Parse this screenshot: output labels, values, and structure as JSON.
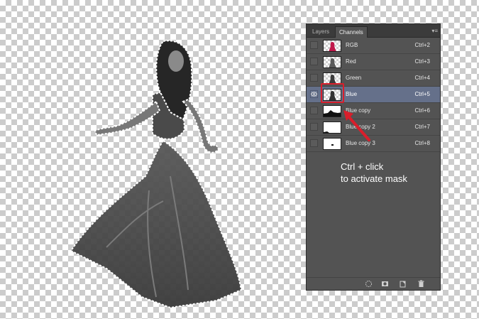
{
  "tabs": [
    {
      "label": "Layers",
      "active": false
    },
    {
      "label": "Channels",
      "active": true
    }
  ],
  "channels": [
    {
      "name": "RGB",
      "shortcut": "Ctrl+2",
      "visible": false,
      "selected": false,
      "thumb_icon": "rgb-thumbnail"
    },
    {
      "name": "Red",
      "shortcut": "Ctrl+3",
      "visible": false,
      "selected": false,
      "thumb_icon": "red-channel-thumbnail"
    },
    {
      "name": "Green",
      "shortcut": "Ctrl+4",
      "visible": false,
      "selected": false,
      "thumb_icon": "green-channel-thumbnail"
    },
    {
      "name": "Blue",
      "shortcut": "Ctrl+5",
      "visible": true,
      "selected": true,
      "thumb_icon": "blue-channel-thumbnail"
    },
    {
      "name": "Blue copy",
      "shortcut": "Ctrl+6",
      "visible": false,
      "selected": false,
      "thumb_icon": "alpha-channel-thumbnail"
    },
    {
      "name": "Blue copy 2",
      "shortcut": "Ctrl+7",
      "visible": false,
      "selected": false,
      "thumb_icon": "alpha-channel-thumbnail"
    },
    {
      "name": "Blue copy 3",
      "shortcut": "Ctrl+8",
      "visible": false,
      "selected": false,
      "thumb_icon": "alpha-channel-thumbnail"
    }
  ],
  "annotation": {
    "line1": "Ctrl + click",
    "line2": "to activate mask"
  },
  "footer_icons": [
    "load-selection-icon",
    "save-selection-icon",
    "new-channel-icon",
    "delete-channel-icon"
  ],
  "colors": {
    "panel_bg": "#535353",
    "selected_row": "#65708a",
    "highlight": "#d91e2b"
  }
}
